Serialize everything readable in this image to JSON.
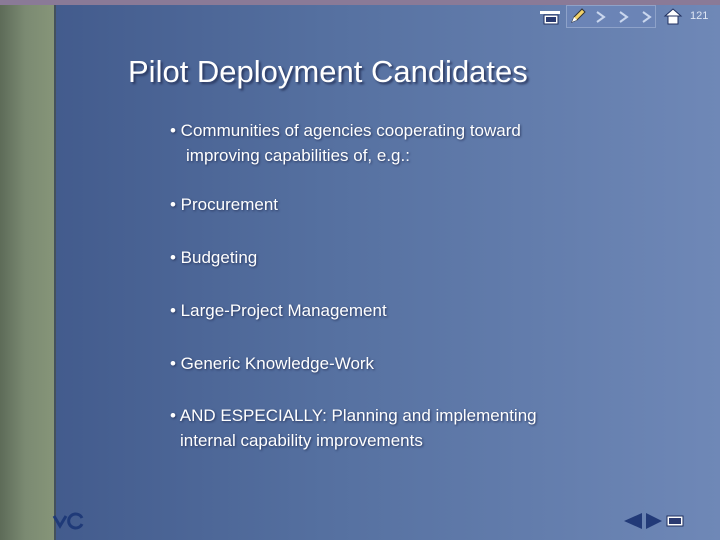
{
  "slide": {
    "title": "Pilot Deployment Candidates",
    "bullets": [
      "• Communities of agencies cooperating toward",
      "improving capabilities of, e.g.:",
      "• Procurement",
      "• Budgeting",
      "• Large-Project Management",
      "• Generic Knowledge-Work",
      "• AND ESPECIALLY:  Planning and implementing",
      "internal capability improvements"
    ],
    "page_number": "121"
  },
  "toolbar": {
    "icons": [
      "slides-icon",
      "pen-icon",
      "arrow-icon",
      "arrow-icon",
      "arrow-icon",
      "home-icon"
    ]
  },
  "colors": {
    "background_left": "#3f5789",
    "background_right": "#6f88b7",
    "strip": "#7b8a72",
    "text": "#ffffff"
  }
}
